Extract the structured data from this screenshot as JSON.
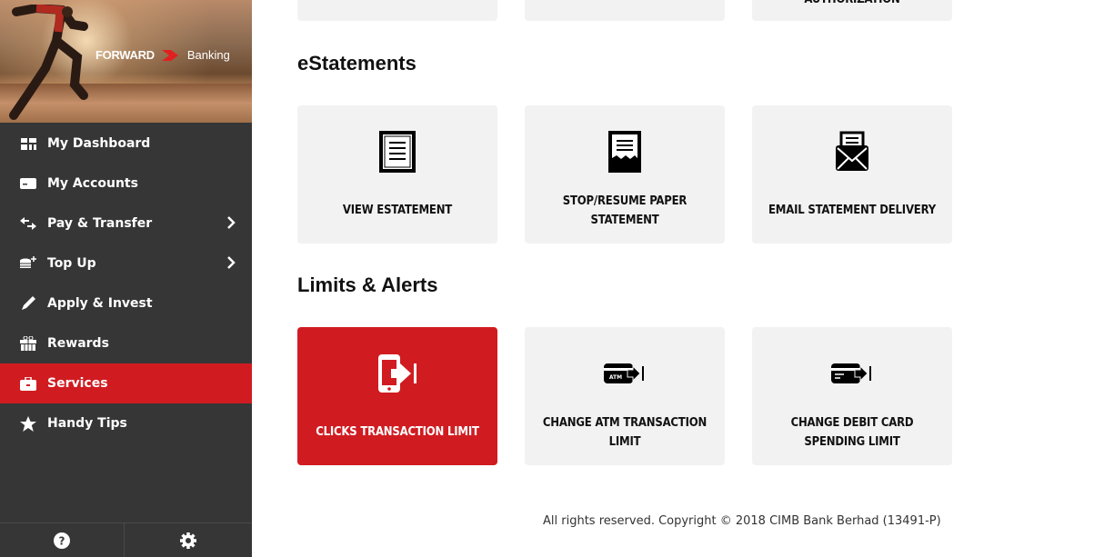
{
  "brand": {
    "logo_word1": "FORWARD",
    "logo_word2": "Banking"
  },
  "sidebar": {
    "items": [
      {
        "label": "My Dashboard",
        "icon": "dashboard-icon"
      },
      {
        "label": "My Accounts",
        "icon": "card-icon"
      },
      {
        "label": "Pay & Transfer",
        "icon": "transfer-icon",
        "has_submenu": true
      },
      {
        "label": "Top Up",
        "icon": "coins-icon",
        "has_submenu": true
      },
      {
        "label": "Apply & Invest",
        "icon": "pen-icon"
      },
      {
        "label": "Rewards",
        "icon": "gift-icon"
      },
      {
        "label": "Services",
        "icon": "briefcase-icon",
        "active": true
      },
      {
        "label": "Handy Tips",
        "icon": "star-icon"
      }
    ],
    "bottom": [
      "help-icon",
      "settings-icon"
    ]
  },
  "main": {
    "top_row": [
      {
        "label": ""
      },
      {
        "label": ""
      },
      {
        "label": "AUTHORIZATION"
      }
    ],
    "estatements": {
      "title": "eStatements",
      "cards": [
        {
          "label": "VIEW ESTATEMENT",
          "icon": "document-icon"
        },
        {
          "label": "STOP/RESUME PAPER STATEMENT",
          "icon": "paper-statement-icon"
        },
        {
          "label": "EMAIL STATEMENT DELIVERY",
          "icon": "email-statement-icon"
        }
      ]
    },
    "limits": {
      "title": "Limits & Alerts",
      "cards": [
        {
          "label": "CLICKS TRANSACTION LIMIT",
          "icon": "mobile-limit-icon",
          "active": true
        },
        {
          "label": "CHANGE ATM TRANSACTION LIMIT",
          "icon": "atm-card-limit-icon"
        },
        {
          "label": "CHANGE DEBIT CARD SPENDING LIMIT",
          "icon": "debit-card-limit-icon"
        }
      ]
    }
  },
  "footer": {
    "text": "All rights reserved. Copyright © 2018 CIMB Bank Berhad (13491-P)"
  },
  "colors": {
    "accent": "#d01c21",
    "sidebar": "#363636",
    "card": "#f2f2f2"
  }
}
